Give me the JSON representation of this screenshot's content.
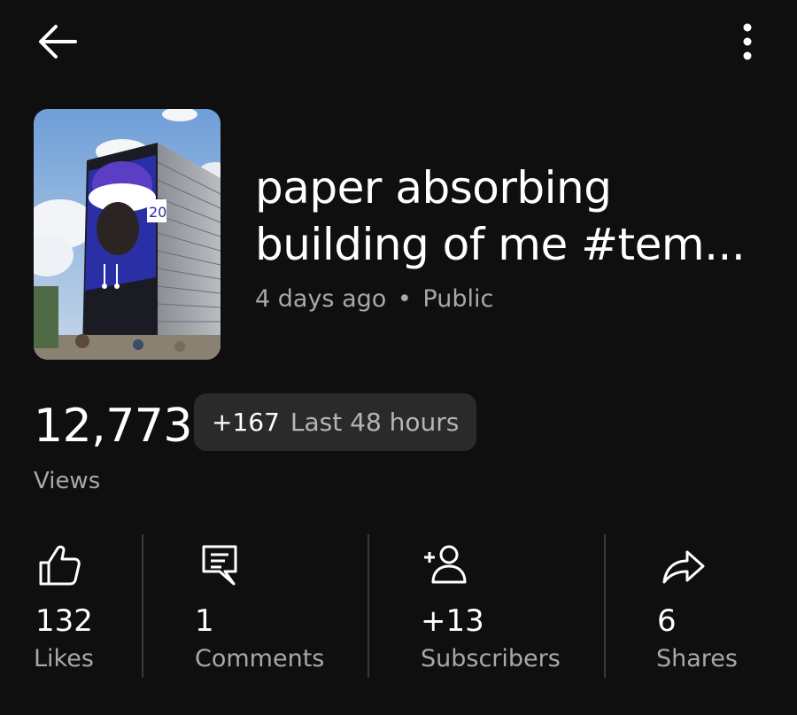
{
  "header": {
    "back_icon": "arrow-left-icon",
    "more_icon": "more-vertical-icon"
  },
  "video": {
    "title": "paper absorbing building of me #tem...",
    "posted": "4 days ago",
    "separator": "•",
    "visibility": "Public",
    "thumbnail_label": "20"
  },
  "views": {
    "count": "12,773",
    "delta_value": "+167",
    "delta_label": "Last 48 hours",
    "label": "Views"
  },
  "stats": [
    {
      "icon": "thumbs-up-icon",
      "value": "132",
      "label": "Likes"
    },
    {
      "icon": "comment-icon",
      "value": "1",
      "label": "Comments"
    },
    {
      "icon": "add-person-icon",
      "value": "+13",
      "label": "Subscribers"
    },
    {
      "icon": "share-icon",
      "value": "6",
      "label": "Shares"
    }
  ],
  "colors": {
    "background": "#0f0f10",
    "text_primary": "#ffffff",
    "text_secondary": "#a8a8a8",
    "chip_bg": "#2a2a2a"
  }
}
